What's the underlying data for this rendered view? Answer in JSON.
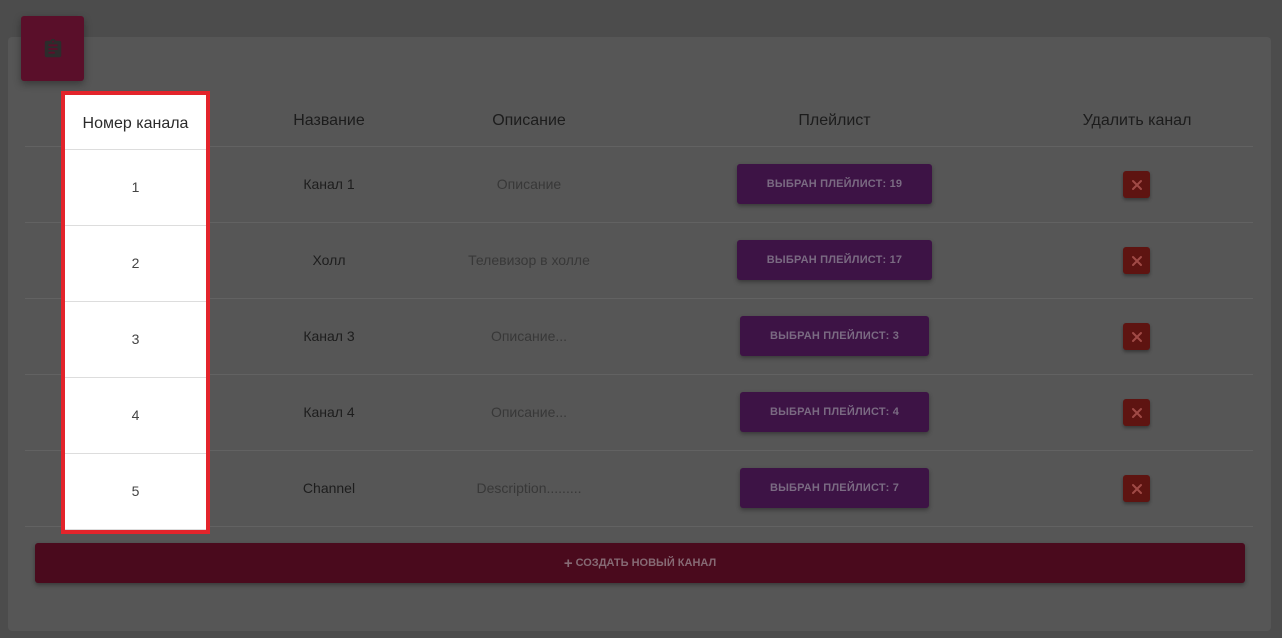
{
  "headers": {
    "number": "Номер канала",
    "name": "Название",
    "description": "Описание",
    "playlist": "Плейлист",
    "delete": "Удалить канал"
  },
  "rows": [
    {
      "number": "1",
      "name": "Канал 1",
      "description": "Описание",
      "playlist": "Выбран плейлист: 19"
    },
    {
      "number": "2",
      "name": "Холл",
      "description": "Телевизор в холле",
      "playlist": "Выбран плейлист: 17"
    },
    {
      "number": "3",
      "name": "Канал 3",
      "description": "Описание...",
      "playlist": "Выбран плейлист: 3"
    },
    {
      "number": "4",
      "name": "Канал 4",
      "description": "Описание...",
      "playlist": "Выбран плейлист: 4"
    },
    {
      "number": "5",
      "name": "Channel",
      "description": "Description.........",
      "playlist": "Выбран плейлист: 7"
    }
  ],
  "create_button": {
    "icon": "plus-icon",
    "label": "Создать новый канал"
  },
  "card_icon": "clipboard-icon",
  "delete_icon": "close-icon",
  "colors": {
    "overlay": "#4c4c4c",
    "highlight_border": "#e3242b",
    "playlist_button": "#3d1345",
    "delete_button": "#5e1411",
    "create_button": "#4a0a1d",
    "card_icon_bg": "#5a0f2a"
  }
}
